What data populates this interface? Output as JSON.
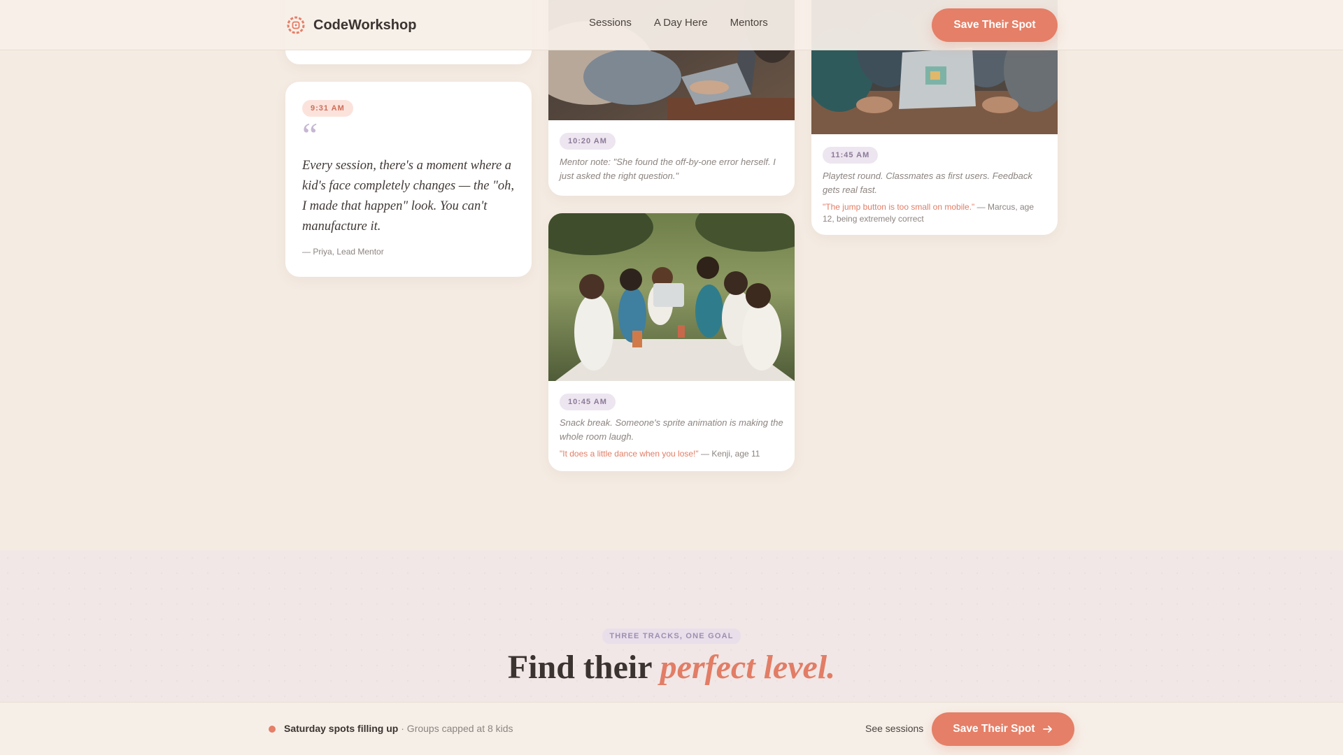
{
  "header": {
    "brand": "CodeWorkshop",
    "nav": [
      "Sessions",
      "A Day Here",
      "Mentors"
    ],
    "cta_label": "Save Their Spot"
  },
  "timeline": {
    "quote_card": {
      "time": "9:31 AM",
      "quote_mark": "“",
      "quote": "Every session, there's a moment where a kid's face completely changes — the \"oh, I made that happen\" look. You can't manufacture it.",
      "attribution": "— Priya, Lead Mentor"
    },
    "card_1020": {
      "time": "10:20 AM",
      "caption": "Mentor note: \"She found the off-by-one error herself. I just asked the right question.\""
    },
    "card_1045": {
      "time": "10:45 AM",
      "caption": "Snack break. Someone's sprite animation is making the whole room laugh.",
      "quote": "\"It does a little dance when you lose!\"",
      "author": "— Kenji, age 11"
    },
    "card_1145": {
      "time": "11:45 AM",
      "caption": "Playtest round. Classmates as first users. Feedback gets real fast.",
      "quote": "\"The jump button is too small on mobile.\"",
      "author": "— Marcus, age 12, being extremely correct"
    }
  },
  "levels": {
    "eyebrow": "THREE TRACKS, ONE GOAL",
    "headline_plain": "Find their ",
    "headline_accent": "perfect level."
  },
  "bottom_bar": {
    "status_bold": "Saturday spots filling up",
    "status_rest": " · Groups capped at 8 kids",
    "link": "See sessions",
    "cta_label": "Save Their Spot"
  },
  "colors": {
    "accent": "#e57f67",
    "background": "#f4ebe2",
    "lavender": "#9d8fb0"
  }
}
